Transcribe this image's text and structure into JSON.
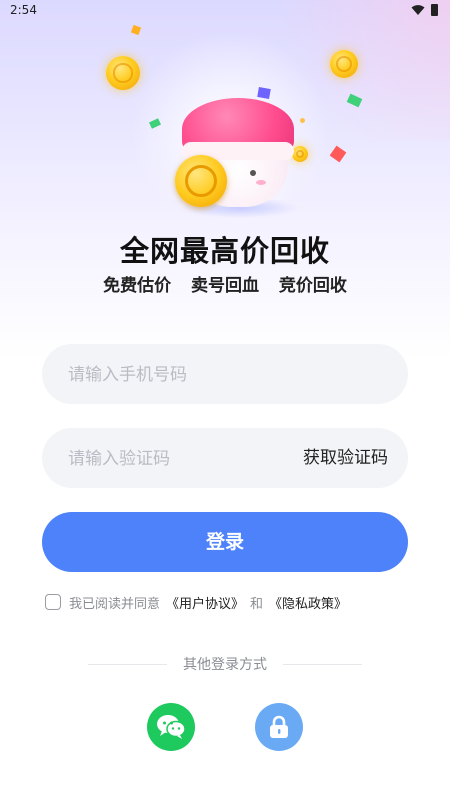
{
  "status_bar": {
    "time": "2:54",
    "icons": [
      "wifi-icon",
      "battery-icon"
    ]
  },
  "hero": {
    "headline": "全网最高价回收",
    "features": [
      "免费估价",
      "卖号回血",
      "竞价回收"
    ]
  },
  "form": {
    "phone_placeholder": "请输入手机号码",
    "code_placeholder": "请输入验证码",
    "get_code_label": "获取验证码",
    "login_label": "登录"
  },
  "agreement": {
    "checked": false,
    "prefix": "我已阅读并同意",
    "user_agreement": "《用户协议》",
    "and": "和",
    "privacy_policy": "《隐私政策》"
  },
  "other_login": {
    "label": "其他登录方式",
    "options": [
      "wechat-icon",
      "lock-icon"
    ]
  },
  "colors": {
    "primary": "#4d82fa",
    "wechat": "#1ec95e",
    "lock": "#6aaaf4",
    "input_bg": "#f3f4f8"
  }
}
